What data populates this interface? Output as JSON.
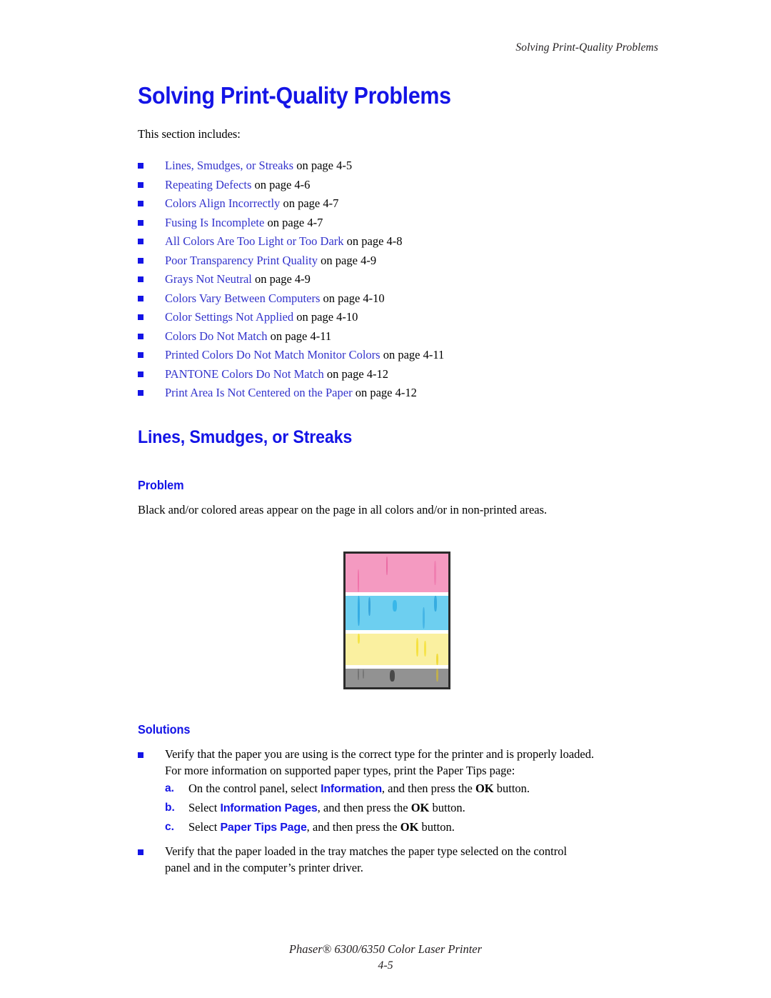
{
  "document": {
    "running_head": "Solving Print-Quality Problems",
    "chapter_title": "Solving Print-Quality Problems",
    "intro": "This section includes:"
  },
  "colors": {
    "heading_blue": "#1414E6",
    "link_blue": "#3333CC",
    "bullet_blue": "#1414E6",
    "body_black": "#000000",
    "figure_border": "#2B2B2B",
    "band_magenta": "#F49AC1",
    "band_cyan": "#6DCFF0",
    "band_yellow": "#FAF0A0",
    "band_gray": "#929292"
  },
  "toc": {
    "items": [
      {
        "link": "Lines, Smudges, or Streaks",
        "tail": " on page 4-5"
      },
      {
        "link": "Repeating Defects",
        "tail": " on page 4-6"
      },
      {
        "link": "Colors Align Incorrectly",
        "tail": " on page 4-7"
      },
      {
        "link": "Fusing Is Incomplete",
        "tail": " on page 4-7"
      },
      {
        "link": "All Colors Are Too Light or Too Dark",
        "tail": " on page 4-8"
      },
      {
        "link": "Poor Transparency Print Quality",
        "tail": " on page 4-9"
      },
      {
        "link": "Grays Not Neutral",
        "tail": " on page 4-9"
      },
      {
        "link": "Colors Vary Between Computers",
        "tail": " on page 4-10"
      },
      {
        "link": "Color Settings Not Applied",
        "tail": " on page 4-10"
      },
      {
        "link": "Colors Do Not Match",
        "tail": " on page 4-11"
      },
      {
        "link": "Printed Colors Do Not Match Monitor Colors",
        "tail": " on page 4-11"
      },
      {
        "link": "PANTONE Colors Do Not Match",
        "tail": " on page 4-12"
      },
      {
        "link": "Print Area Is Not Centered on the Paper",
        "tail": " on page 4-12"
      }
    ]
  },
  "section": {
    "title": "Lines, Smudges, or Streaks",
    "problem_heading": "Problem",
    "problem_text": "Black and/or colored areas appear on the page in all colors and/or in non-printed areas.",
    "solutions_heading": "Solutions"
  },
  "figure": {
    "caption_name": "print-defect-sample",
    "bands": [
      "magenta",
      "cyan",
      "yellow",
      "gray"
    ]
  },
  "solutions": {
    "item1_line1": "Verify that the paper you are using is the correct type for the printer and is properly loaded.",
    "item1_line2": "For more information on supported paper types, print the Paper Tips page:",
    "steps": [
      {
        "marker": "a.",
        "pre": "On the control panel, select ",
        "ui": "Information",
        "mid": ", and then press the ",
        "btn": "OK",
        "post": " button."
      },
      {
        "marker": "b.",
        "pre": "Select ",
        "ui": "Information Pages",
        "mid": ", and then press the ",
        "btn": "OK",
        "post": " button."
      },
      {
        "marker": "c.",
        "pre": "Select ",
        "ui": "Paper Tips Page",
        "mid": ", and then press the ",
        "btn": "OK",
        "post": " button."
      }
    ],
    "item2_line1": "Verify that the paper loaded in the tray matches the paper type selected on the control",
    "item2_line2": "panel and in the computer’s printer driver."
  },
  "footer": {
    "title": "Phaser® 6300/6350 Color Laser Printer",
    "page_number": "4-5"
  }
}
